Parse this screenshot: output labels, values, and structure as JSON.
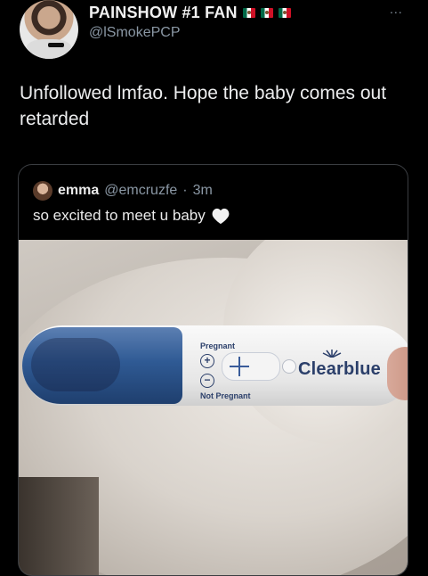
{
  "tweet": {
    "display_name": "PAINSHOW #1 FAN",
    "handle": "@lSmokePCP",
    "more": "...",
    "text": "Unfollowed lmfao. Hope the baby comes out retarded"
  },
  "quote": {
    "name": "emma",
    "handle": "@emcruzfe",
    "separator": "·",
    "time": "3m",
    "text": "so excited to meet u baby",
    "photo": {
      "label_pregnant": "Pregnant",
      "label_not_pregnant": "Not Pregnant",
      "brand": "Clearblue",
      "plus_symbol": "+",
      "minus_symbol": "−"
    }
  },
  "colors": {
    "background": "#000000",
    "text_primary": "#e7e9ea",
    "text_secondary": "#8b98a5",
    "card_border": "#3a3d41",
    "cap_blue": "#2f5a94"
  },
  "icons": [
    "mexico-flag-icon",
    "more-icon",
    "heart-icon"
  ]
}
